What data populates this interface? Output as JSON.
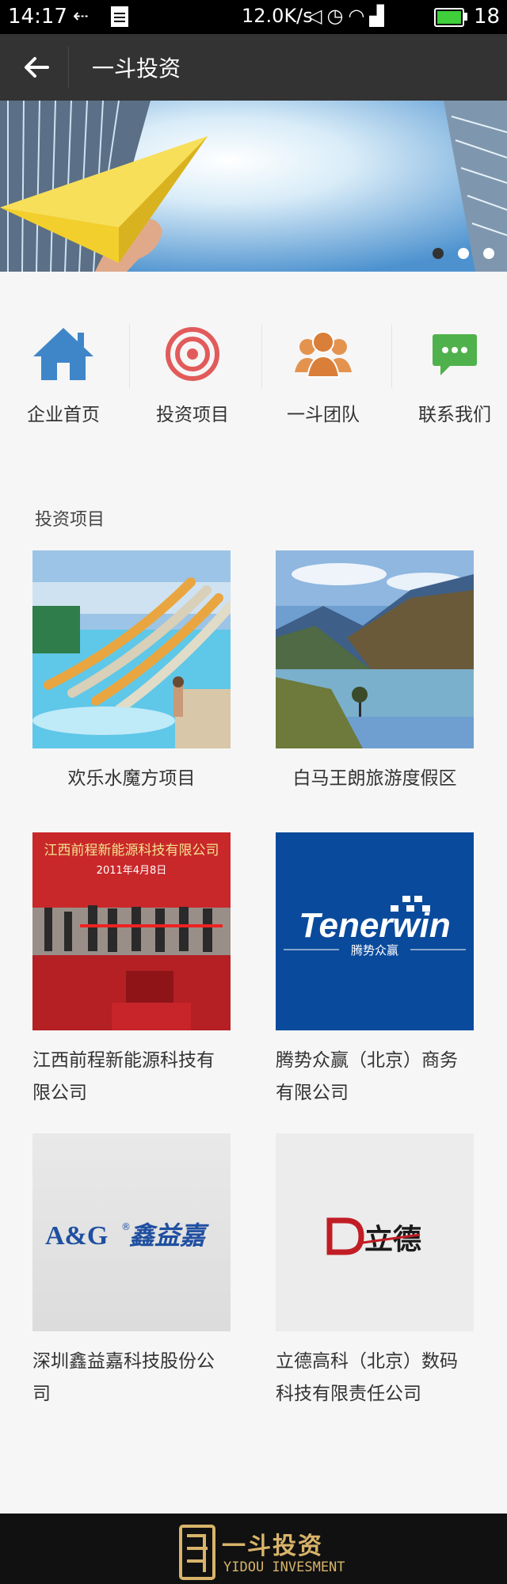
{
  "status_bar": {
    "time": "14:17",
    "net_speed": "12.0K/s",
    "battery": "18"
  },
  "header": {
    "title": "一斗投资"
  },
  "banner": {
    "slide_count": 3,
    "active_slide": 1
  },
  "quick_nav": [
    {
      "label": "企业首页",
      "icon": "home-icon",
      "color": "#3f86c8"
    },
    {
      "label": "投资项目",
      "icon": "target-icon",
      "color": "#e25b5b"
    },
    {
      "label": "一斗团队",
      "icon": "team-icon",
      "color": "#e4934f"
    },
    {
      "label": "联系我们",
      "icon": "chat-icon",
      "color": "#4fb14b"
    }
  ],
  "section": {
    "title": "投资项目"
  },
  "projects": [
    {
      "title": "欢乐水魔方项目"
    },
    {
      "title": "白马王朗旅游度假区"
    },
    {
      "title": "江西前程新能源科技有限公司",
      "image_text_1": "江西前程新能源科技有限公司",
      "image_text_2": "2011年4月8日"
    },
    {
      "title": "腾势众赢（北京）商务有限公司",
      "image_text_1": "Tenerwin",
      "image_text_2": "腾势众赢"
    },
    {
      "title": "深圳鑫益嘉科技股份公司",
      "image_text_1": "A&G",
      "image_text_2": "鑫益嘉"
    },
    {
      "title": "立德高科（北京）数码科技有限责任公司",
      "image_text_1": "立德"
    }
  ],
  "footer": {
    "brand_cn": "一斗投资",
    "brand_en": "YIDOU INVESMENT"
  },
  "colors": {
    "header_bg": "#333334",
    "footer_bg": "#111111",
    "footer_gold": "#d8b46a"
  }
}
